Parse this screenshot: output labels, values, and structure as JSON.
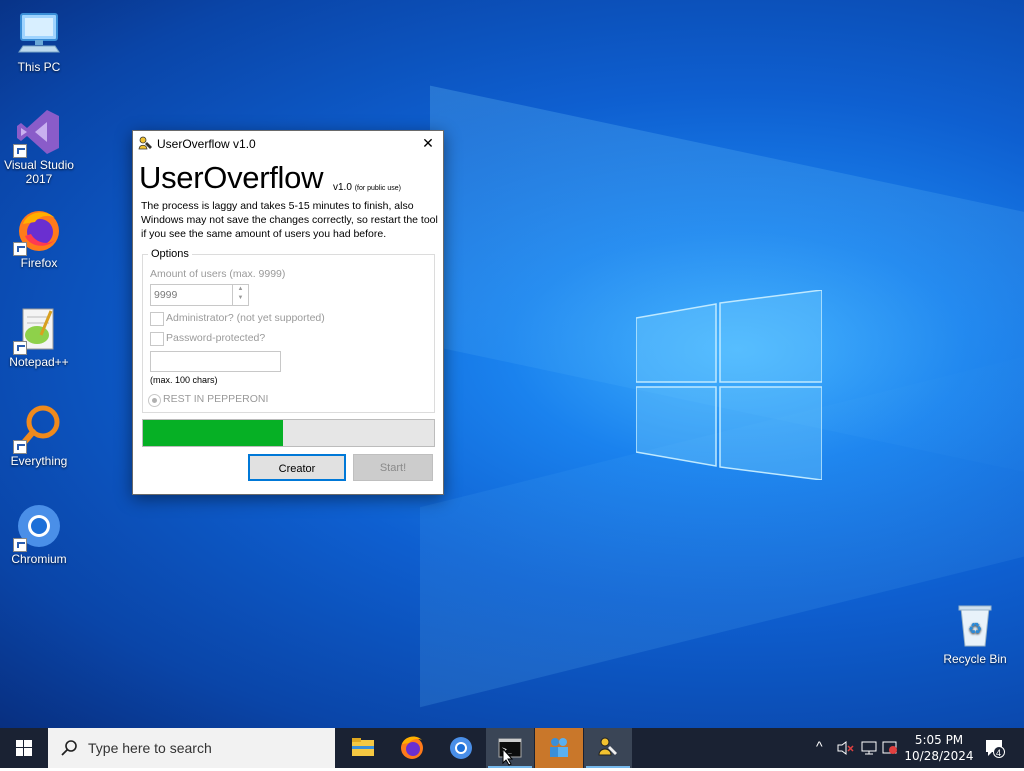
{
  "desktop_icons": [
    {
      "label": "This PC",
      "icon": "this-pc-icon"
    },
    {
      "label": "Visual Studio 2017",
      "icon": "visual-studio-icon"
    },
    {
      "label": "Firefox",
      "icon": "firefox-icon"
    },
    {
      "label": "Notepad++",
      "icon": "notepadpp-icon"
    },
    {
      "label": "Everything",
      "icon": "everything-icon"
    },
    {
      "label": "Chromium",
      "icon": "chromium-icon"
    },
    {
      "label": "Recycle Bin",
      "icon": "recycle-bin-icon"
    }
  ],
  "dialog": {
    "window_title": "UserOverflow v1.0",
    "close_glyph": "✕",
    "heading": "UserOverflow",
    "version": "v1.0",
    "version_note": "(for public use)",
    "description": "The process is laggy and takes 5-15 minutes to finish, also Windows may not save the changes correctly, so restart the tool if you see the same amount of users you had before.",
    "options_legend": "Options",
    "amount_label": "Amount of users (max. 9999)",
    "amount_value": "9999",
    "admin_label": "Administrator? (not yet supported)",
    "password_label": "Password-protected?",
    "password_hint": "(max. 100 chars)",
    "radio_label": "REST IN PEPPERONI",
    "progress_fraction": 0.48,
    "creator_button": "Creator",
    "start_button": "Start!"
  },
  "taskbar": {
    "search_placeholder": "Type here to search",
    "apps": [
      "file-explorer-icon",
      "firefox-icon",
      "chromium-icon",
      "command-prompt-icon",
      "people-app-icon",
      "useroverflow-icon"
    ],
    "time": "5:05 PM",
    "date": "10/28/2024",
    "notification_count": "4"
  },
  "colors": {
    "progress_fill": "#06b025",
    "accent": "#0078d7",
    "taskbar": "#1a2233"
  }
}
